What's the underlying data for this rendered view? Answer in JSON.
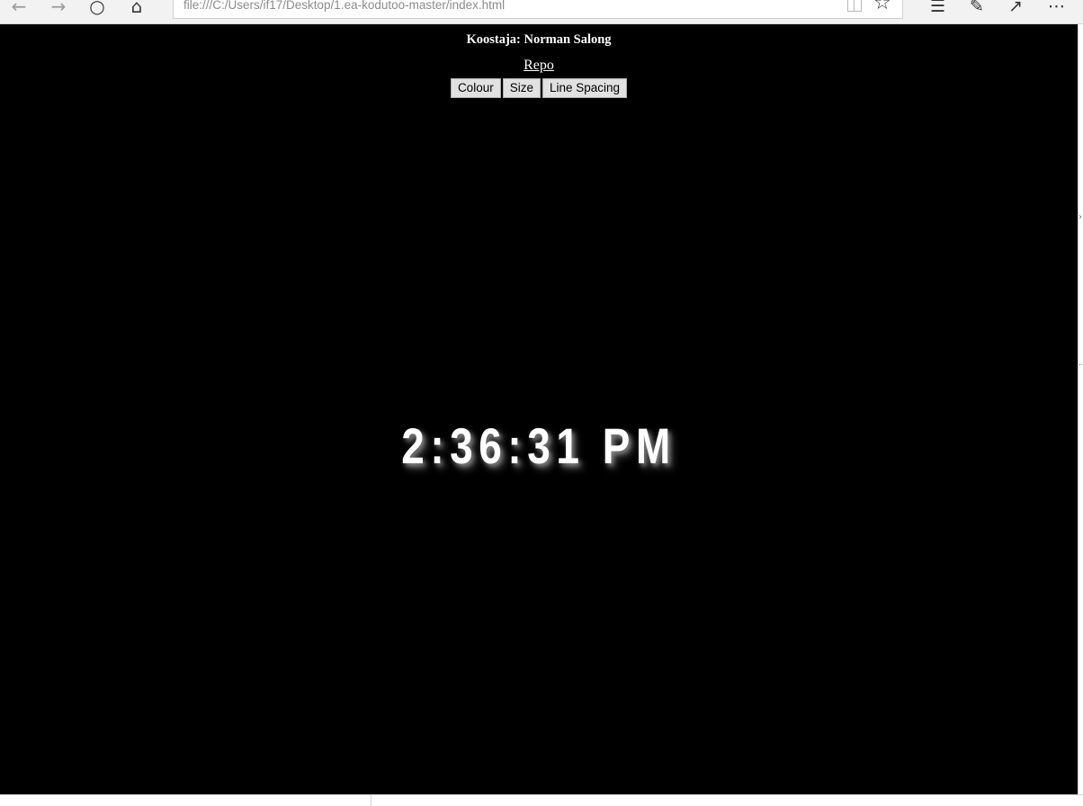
{
  "browser": {
    "address": "file:///C:/Users/if17/Desktop/1.ea-kodutoo-master/index.html",
    "icons": [
      "back-icon",
      "forward-icon",
      "refresh-icon",
      "home-icon",
      "reading-view-icon",
      "favorite-star-icon",
      "favorites-list-icon",
      "pen-notes-icon",
      "share-icon",
      "more-icon"
    ]
  },
  "page": {
    "author": "Koostaja: Norman Salong",
    "repo_link": "Repo",
    "buttons": {
      "colour": "Colour",
      "size": "Size",
      "line_spacing": "Line Spacing"
    },
    "clock": "2:36:31 PM"
  },
  "colors": {
    "page_background": "#000000",
    "text": "#ffffff",
    "button_background": "#e1e1e1"
  }
}
